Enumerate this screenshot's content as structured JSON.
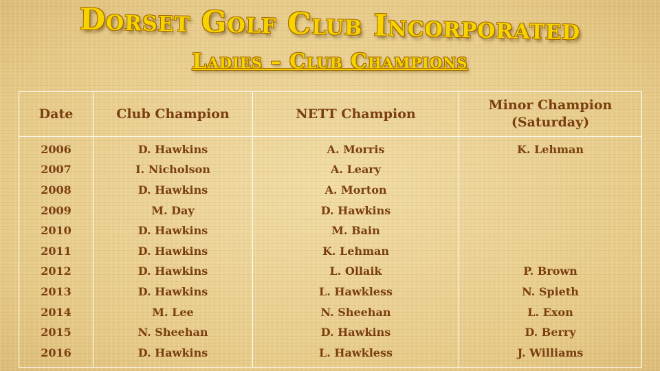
{
  "header": {
    "title": "Dorset Golf Club Incorporated",
    "subtitle": "Ladies – Club Champions"
  },
  "table": {
    "columns": [
      "Date",
      "Club Champion",
      "NETT Champion",
      "Minor Champion (Saturday)"
    ],
    "rows": [
      {
        "date": "2006",
        "club": "D. Hawkins",
        "nett": "A. Morris",
        "minor": "K. Lehman"
      },
      {
        "date": "2007",
        "club": "I. Nicholson",
        "nett": "A. Leary",
        "minor": ""
      },
      {
        "date": "2008",
        "club": "D. Hawkins",
        "nett": "A. Morton",
        "minor": ""
      },
      {
        "date": "2009",
        "club": "M. Day",
        "nett": "D. Hawkins",
        "minor": ""
      },
      {
        "date": "2010",
        "club": "D. Hawkins",
        "nett": "M. Bain",
        "minor": ""
      },
      {
        "date": "2011",
        "club": "D. Hawkins",
        "nett": "K. Lehman",
        "minor": ""
      },
      {
        "date": "2012",
        "club": "D. Hawkins",
        "nett": "L. Ollaik",
        "minor": "P. Brown"
      },
      {
        "date": "2013",
        "club": "D. Hawkins",
        "nett": "L. Hawkless",
        "minor": "N. Spieth"
      },
      {
        "date": "2014",
        "club": "M. Lee",
        "nett": "N. Sheehan",
        "minor": "L. Exon"
      },
      {
        "date": "2015",
        "club": "N. Sheehan",
        "nett": "D. Hawkins",
        "minor": "D. Berry"
      },
      {
        "date": "2016",
        "club": "D. Hawkins",
        "nett": "L. Hawkless",
        "minor": "J. Williams"
      }
    ]
  },
  "colors": {
    "title_fill": "#f7d300",
    "title_outline": "#a36a00",
    "table_text": "#7a3e10",
    "table_border": "#ffffff",
    "background": "#e9cf8f"
  }
}
